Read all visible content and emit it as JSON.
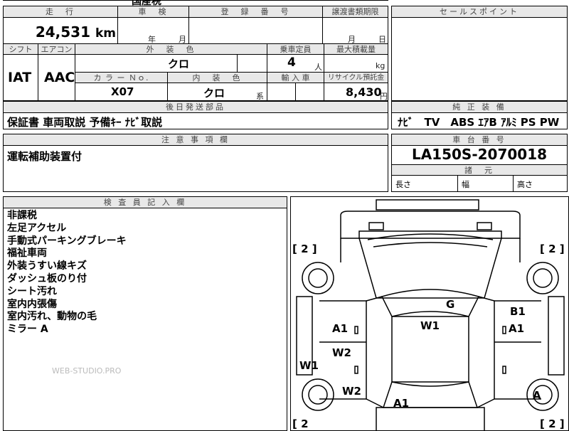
{
  "top_cutoff_text": "国産税",
  "headers": {
    "mileage": "走　行",
    "inspection": "車　検",
    "reg_no": "登　録　番　号",
    "transfer": "譲渡書類期限",
    "sales_point": "セールスポイント",
    "shift": "シフト",
    "aircon": "エアコン",
    "ext_color": "外　装　色",
    "capacity": "乗車定員",
    "max_load": "最大積載量",
    "color_no": "カ ラ ー Ｎｏ.",
    "int_color": "内　装　色",
    "import": "輸 入 車",
    "recycle": "リサイクル預託金",
    "parts_later": "後日発送部品",
    "equipment": "純 正 装 備",
    "notes": "注 意 事 項 欄",
    "chassis_no": "車 台 番 号",
    "dimensions": "諸　元",
    "inspector": "検 査 員 記 入 欄"
  },
  "mileage": {
    "value": "24,531",
    "unit": "km"
  },
  "inspection": {
    "year_label": "年",
    "month_label": "月"
  },
  "transfer": {
    "month_label": "月",
    "day_label": "日"
  },
  "shift": "IAT",
  "aircon": "AAC",
  "ext_color": "クロ",
  "capacity": {
    "value": "4",
    "unit": "人"
  },
  "max_load": {
    "unit": "kg"
  },
  "color_no": "X07",
  "int_color": {
    "value": "クロ",
    "suffix": "系"
  },
  "recycle": {
    "value": "8,430",
    "unit": "円"
  },
  "parts_later_text": "保証書 車両取説 予備ｷｰ ﾅﾋﾞ取説",
  "equipment_text": "ﾅﾋﾞ　TV　ABS ｴｱB ｱﾙﾐ PS PW",
  "notes_text": "運転補助装置付",
  "chassis_no": "LA150S-2070018",
  "dimensions": {
    "length": "長さ",
    "width": "幅",
    "height": "高さ"
  },
  "inspector_lines": [
    "非課税",
    "左足アクセル",
    "手動式パーキングブレーキ",
    "福祉車両",
    "外装うすい線キズ",
    "ダッシュ板のり付",
    "シート汚れ",
    "室内内張傷",
    "室内汚れ、動物の毛",
    "ミラー A"
  ],
  "watermark": "WEB-STUDIO.PRO",
  "diagram": {
    "tire_tl": "[ 2 ]",
    "tire_tr": "[ 2 ]",
    "tire_bl": "[ 2",
    "tire_br": "[ 2 ]",
    "marks": [
      "G",
      "W1",
      "B1",
      "A1",
      "A1",
      "W2",
      "W1",
      "W2",
      "A1",
      "A"
    ]
  }
}
